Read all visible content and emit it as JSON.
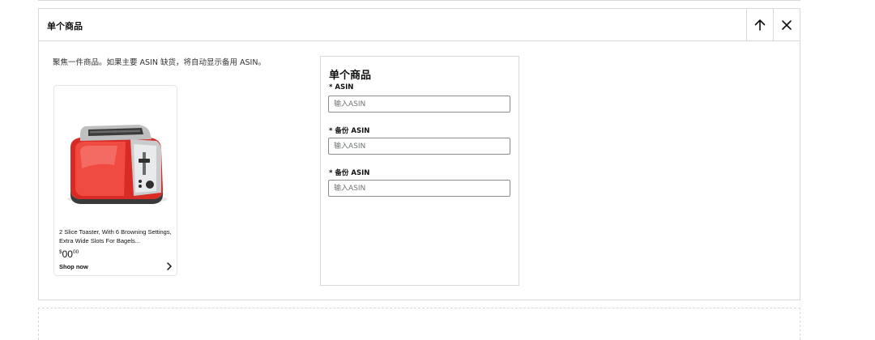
{
  "module": {
    "title": "单个商品",
    "description": "聚焦一件商品。如果主要 ASIN 缺货，将自动显示备用 ASIN。"
  },
  "product_card": {
    "title": "2 Slice Toaster, With 6 Browning Settings, Extra Wide Slots For Bagels...",
    "price_symbol": "$",
    "price_whole": "00",
    "price_fraction": "00",
    "cta": "Shop now"
  },
  "form": {
    "title": "单个商品",
    "fields": [
      {
        "label": "* ASIN",
        "placeholder": "输入ASIN"
      },
      {
        "label": "* 备份 ASIN",
        "placeholder": "输入ASIN"
      },
      {
        "label": "* 备份 ASIN",
        "placeholder": "输入ASIN"
      }
    ]
  },
  "colors": {
    "border": "#d5d9d9",
    "toaster_body": "#e8352f",
    "text": "#0f1111"
  },
  "icons": {
    "move_up": "arrow-up-icon",
    "close": "close-icon",
    "cta": "chevron-right-icon"
  }
}
